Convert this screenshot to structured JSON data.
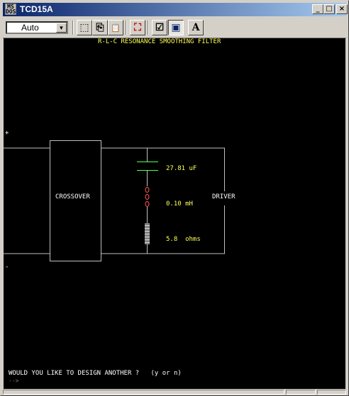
{
  "window": {
    "title": "TCD15A",
    "icon_name": "msdos-icon",
    "icon_text": [
      "MS",
      "DOS"
    ],
    "controls": {
      "minimize": "_",
      "maximize": "□",
      "close": "×"
    }
  },
  "toolbar": {
    "font_select_value": "Auto",
    "font_select_arrow": "▼",
    "buttons": [
      {
        "name": "mark-icon",
        "glyph": "⬚"
      },
      {
        "name": "copy-icon",
        "glyph": "⎘"
      },
      {
        "name": "paste-icon",
        "glyph": "📋"
      },
      {
        "name": "fullscreen-icon",
        "glyph": "⛶"
      },
      {
        "name": "properties-icon",
        "glyph": "☑"
      },
      {
        "name": "background-icon",
        "glyph": "▣"
      },
      {
        "name": "font-icon",
        "glyph": "A"
      }
    ]
  },
  "console": {
    "heading": "R-L-C RESONANCE SMOOTHING FILTER",
    "plus_label": "+",
    "minus_label": "-",
    "crossover_label": "CROSSOVER",
    "driver_label": "DRIVER",
    "capacitance": "27.81 uF",
    "inductance": "0.10 mH",
    "resistance": "5.8  ohms",
    "prompt": "WOULD YOU LIKE TO DESIGN ANOTHER ?   (y or n)",
    "input_cursor": "-->",
    "colors": {
      "background": "#000000",
      "wire": "#c0c0c0",
      "heading": "#ffff55",
      "values": "#ffff55",
      "capacitor": "#55ff55",
      "inductor": "#ff5555",
      "resistor": "#c0c0c0",
      "text": "#ffffff"
    }
  }
}
